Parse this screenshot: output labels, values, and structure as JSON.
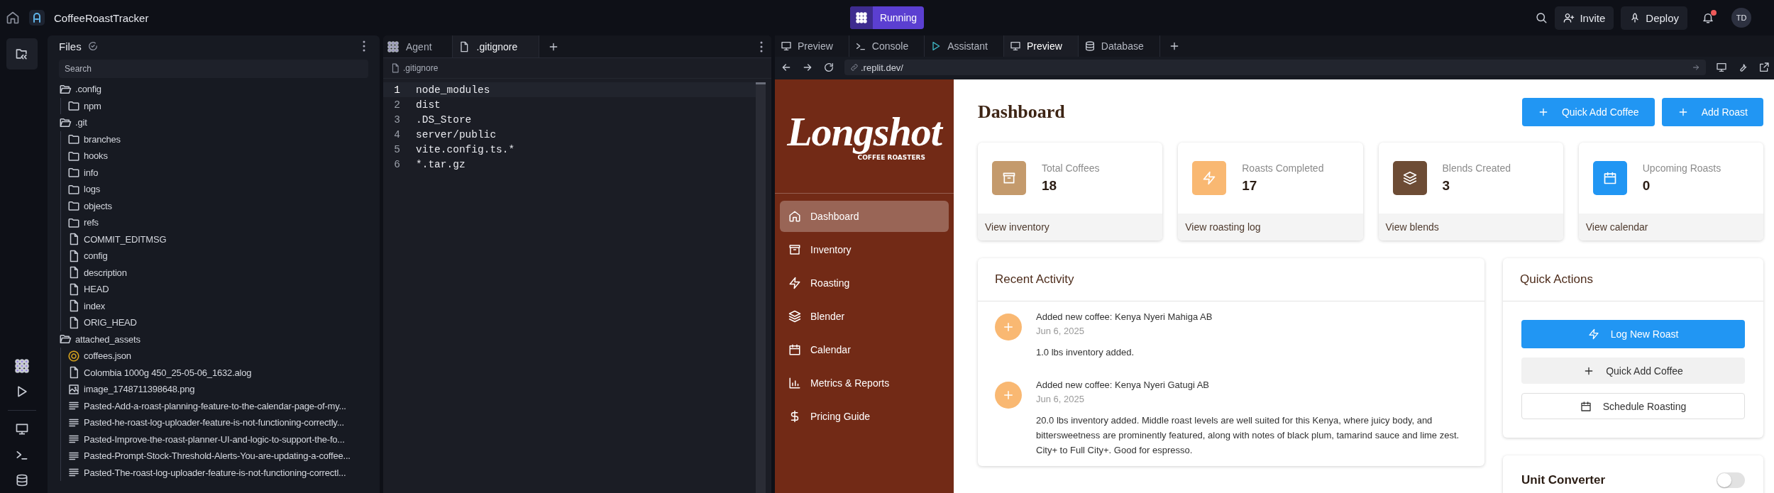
{
  "topbar": {
    "project": "CoffeeRoastTracker",
    "status": "Running",
    "actions": [
      {
        "label": "Invite",
        "kind": "invite"
      },
      {
        "label": "Deploy",
        "kind": "deploy"
      }
    ],
    "notification": true,
    "avatar": "TD"
  },
  "files": {
    "title": "Files",
    "placeholder": "Search",
    "tree": [
      {
        "name": ".config",
        "kind": "folder",
        "expanded": true,
        "children": [
          {
            "name": "npm",
            "kind": "folder",
            "expanded": false
          }
        ]
      },
      {
        "name": ".git",
        "kind": "folder",
        "expanded": true,
        "children": [
          {
            "name": "branches",
            "kind": "folder",
            "expanded": false
          },
          {
            "name": "hooks",
            "kind": "folder",
            "expanded": false
          },
          {
            "name": "info",
            "kind": "folder",
            "expanded": false
          },
          {
            "name": "logs",
            "kind": "folder",
            "expanded": false
          },
          {
            "name": "objects",
            "kind": "folder",
            "expanded": false
          },
          {
            "name": "refs",
            "kind": "folder",
            "expanded": false
          },
          {
            "name": "COMMIT_EDITMSG",
            "kind": "file"
          },
          {
            "name": "config",
            "kind": "file"
          },
          {
            "name": "description",
            "kind": "file"
          },
          {
            "name": "HEAD",
            "kind": "file"
          },
          {
            "name": "index",
            "kind": "file"
          },
          {
            "name": "ORIG_HEAD",
            "kind": "file"
          }
        ]
      },
      {
        "name": "attached_assets",
        "kind": "folder",
        "expanded": true,
        "children": [
          {
            "name": "coffees.json",
            "kind": "json"
          },
          {
            "name": "Colombia 1000g 450_25-05-06_1632.alog",
            "kind": "file"
          },
          {
            "name": "image_1748711398648.png",
            "kind": "image"
          },
          {
            "name": "Pasted-Add-a-roast-planning-feature-to-the-calendar-page-of-my...",
            "kind": "text"
          },
          {
            "name": "Pasted-he-roast-log-uploader-feature-is-not-functioning-correctly...",
            "kind": "text"
          },
          {
            "name": "Pasted-Improve-the-roast-planner-UI-and-logic-to-support-the-fo...",
            "kind": "text"
          },
          {
            "name": "Pasted-Prompt-Stock-Threshold-Alerts-You-are-updating-a-coffee...",
            "kind": "text"
          },
          {
            "name": "Pasted-The-roast-log-uploader-feature-is-not-functioning-correctl...",
            "kind": "text"
          }
        ]
      }
    ]
  },
  "editor": {
    "tabs": [
      {
        "label": "Agent",
        "kind": "agent",
        "selected": false
      },
      {
        "label": ".gitignore",
        "kind": "file",
        "selected": true
      }
    ],
    "breadcrumb": ".gitignore",
    "lines": [
      {
        "number": "1",
        "text": "node_modules",
        "active": true
      },
      {
        "number": "2",
        "text": "dist",
        "active": false
      },
      {
        "number": "3",
        "text": ".DS_Store",
        "active": false
      },
      {
        "number": "4",
        "text": "server/public",
        "active": false
      },
      {
        "number": "5",
        "text": "vite.config.ts.*",
        "active": false
      },
      {
        "number": "6",
        "text": "*.tar.gz",
        "active": false
      }
    ]
  },
  "preview": {
    "tabs": [
      {
        "label": "Preview",
        "kind": "monitor",
        "selected": false
      },
      {
        "label": "Console",
        "kind": "terminal",
        "selected": false
      },
      {
        "label": "Assistant",
        "kind": "assistant",
        "selected": false
      },
      {
        "label": "Preview",
        "kind": "monitor",
        "selected": true
      },
      {
        "label": "Database",
        "kind": "database",
        "selected": false
      }
    ],
    "url": ".replit.dev/"
  },
  "app": {
    "logo": {
      "word": "Longshot",
      "tagline": "COFFEE ROASTERS"
    },
    "nav": [
      {
        "label": "Dashboard",
        "kind": "dashboard",
        "selected": true
      },
      {
        "label": "Inventory",
        "kind": "inventory",
        "selected": false
      },
      {
        "label": "Roasting",
        "kind": "roasting",
        "selected": false
      },
      {
        "label": "Blender",
        "kind": "blender",
        "selected": false
      },
      {
        "label": "Calendar",
        "kind": "calendar",
        "selected": false
      },
      {
        "label": "Metrics & Reports",
        "kind": "metrics",
        "selected": false
      },
      {
        "label": "Pricing Guide",
        "kind": "pricing",
        "selected": false
      }
    ],
    "title": "Dashboard",
    "header_buttons": [
      "Quick Add Coffee",
      "Add Roast"
    ],
    "stats": [
      {
        "label": "Total Coffees",
        "value": "18",
        "link": "View inventory",
        "kind": "inventory",
        "color": "#c49a6c"
      },
      {
        "label": "Roasts Completed",
        "value": "17",
        "link": "View roasting log",
        "kind": "roasting",
        "color": "#f9b872"
      },
      {
        "label": "Blends Created",
        "value": "3",
        "link": "View blends",
        "kind": "blender",
        "color": "#6d4c35"
      },
      {
        "label": "Upcoming Roasts",
        "value": "0",
        "link": "View calendar",
        "kind": "calendar",
        "color": "#2196f3"
      }
    ],
    "recent": {
      "title": "Recent Activity",
      "items": [
        {
          "title": "Added new coffee: Kenya Nyeri Mahiga AB",
          "date": "Jun 6, 2025",
          "detail": "1.0 lbs inventory added."
        },
        {
          "title": "Added new coffee: Kenya Nyeri Gatugi AB",
          "date": "Jun 6, 2025",
          "detail": "20.0 lbs inventory added. Middle roast levels are well suited for this Kenya, where juicy body, and bittersweetness are prominently featured, along with notes of black plum, tamarind sauce and lime zest. City+ to Full City+. Good for espresso."
        }
      ]
    },
    "quick_actions": {
      "title": "Quick Actions",
      "buttons": [
        {
          "label": "Log New Roast",
          "kind": "primary"
        },
        {
          "label": "Quick Add Coffee",
          "kind": "secondary"
        },
        {
          "label": "Schedule Roasting",
          "kind": "outline"
        }
      ]
    },
    "unit_converter": {
      "title": "Unit Converter",
      "on": false
    }
  }
}
